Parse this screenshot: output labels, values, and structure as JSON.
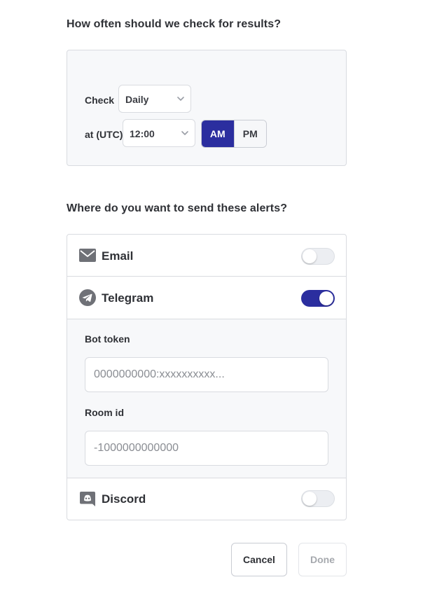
{
  "schedule": {
    "title": "How often should we check for results?",
    "check_label": "Check",
    "frequency_value": "Daily",
    "time_label": "at (UTC)",
    "time_value": "12:00",
    "am_label": "AM",
    "pm_label": "PM",
    "selected_period": "AM"
  },
  "alerts": {
    "title": "Where do you want to send these alerts?",
    "channels": [
      {
        "label": "Email",
        "icon": "envelope-icon",
        "enabled": false
      },
      {
        "label": "Telegram",
        "icon": "telegram-icon",
        "enabled": true
      },
      {
        "label": "Discord",
        "icon": "discord-icon",
        "enabled": false
      }
    ],
    "telegram": {
      "bot_token_label": "Bot token",
      "bot_token_placeholder": "0000000000:xxxxxxxxxx...",
      "room_id_label": "Room id",
      "room_id_placeholder": "-1000000000000"
    }
  },
  "footer": {
    "cancel_label": "Cancel",
    "done_label": "Done"
  },
  "colors": {
    "accent": "#2b2e9f",
    "panel_bg": "#f7f8fa",
    "border": "#d9dbe0"
  }
}
